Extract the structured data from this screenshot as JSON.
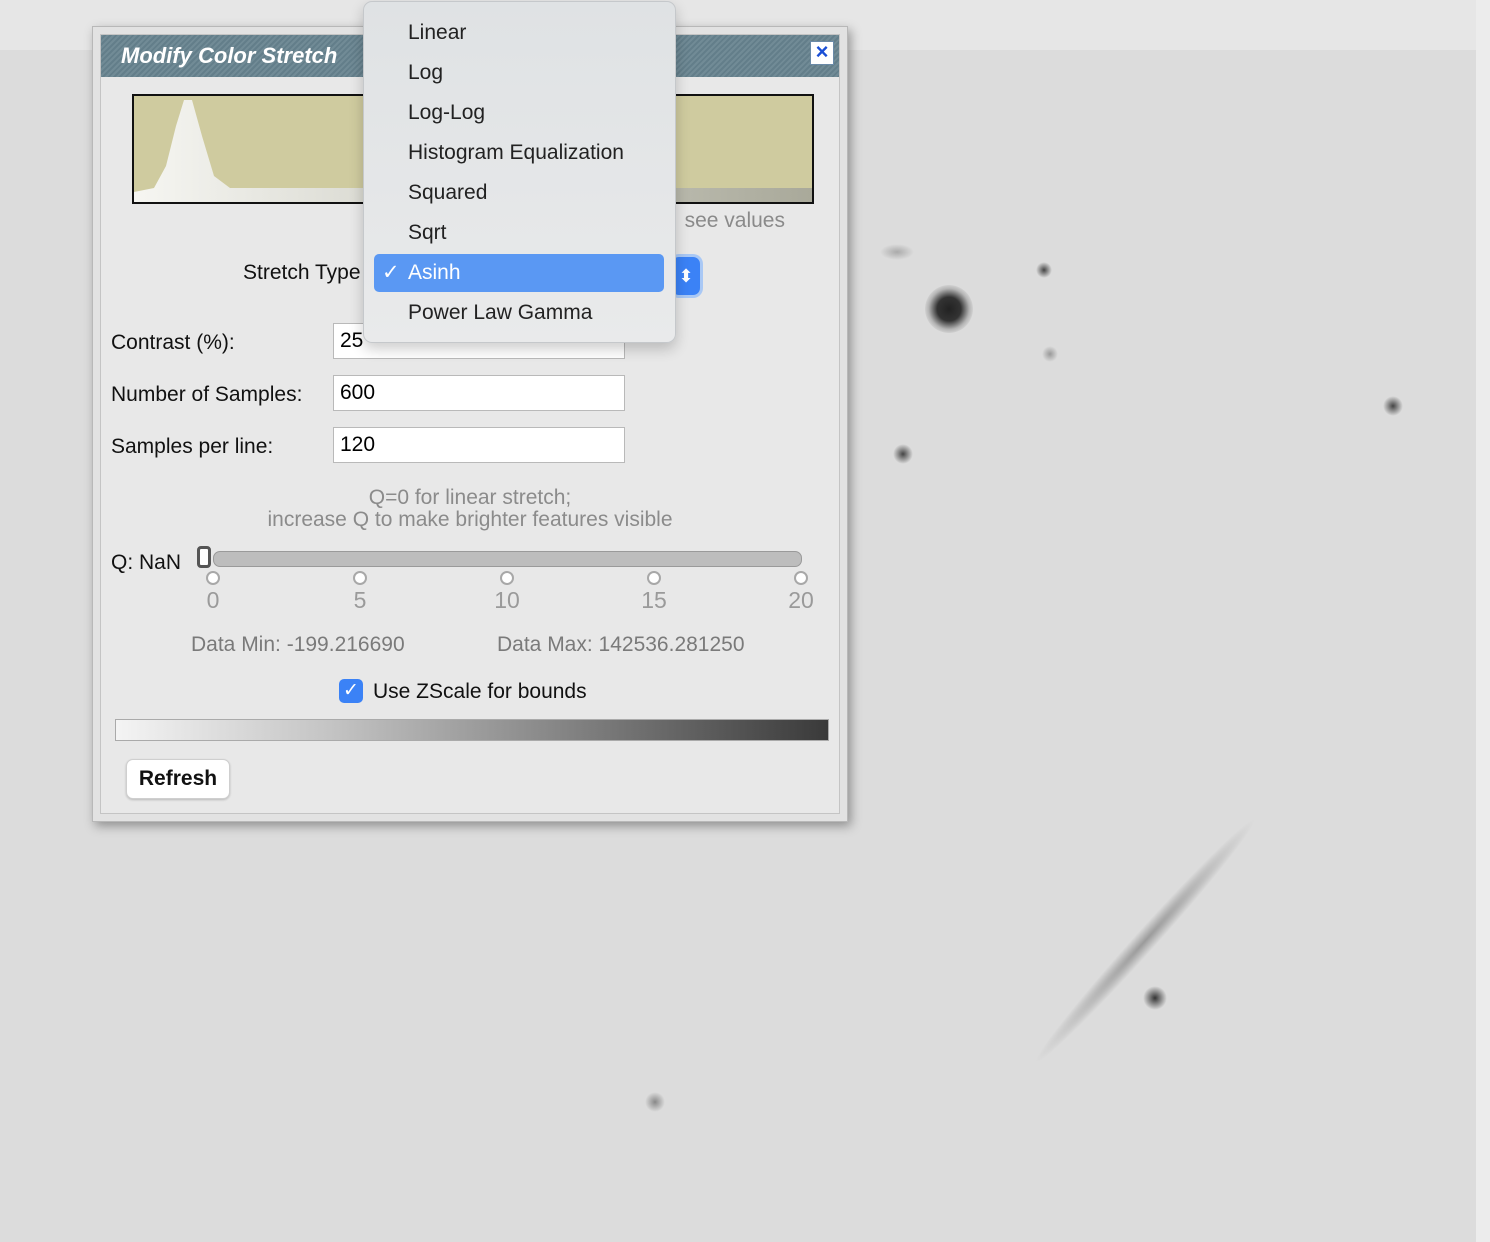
{
  "dialog": {
    "title": "Modify Color Stretch",
    "close_icon": "close-icon",
    "histogram_hint": "see values",
    "stretch_type_label": "Stretch Type",
    "contrast_label": "Contrast (%):",
    "contrast_value": "25",
    "samples_label": "Number of Samples:",
    "samples_value": "600",
    "per_line_label": "Samples per line:",
    "per_line_value": "120",
    "q_help_line1": "Q=0 for linear stretch;",
    "q_help_line2": "increase Q to make brighter features visible",
    "q_label": "Q: NaN",
    "q_ticks": [
      "0",
      "5",
      "10",
      "15",
      "20"
    ],
    "data_min": "Data Min: -199.216690",
    "data_max": "Data Max: 142536.281250",
    "zscale_label": "Use ZScale for bounds",
    "zscale_checked": true,
    "refresh_label": "Refresh"
  },
  "dropdown": {
    "options": [
      "Linear",
      "Log",
      "Log-Log",
      "Histogram Equalization",
      "Squared",
      "Sqrt",
      "Asinh",
      "Power Law Gamma"
    ],
    "selected": "Asinh",
    "check_glyph": "✓"
  },
  "colors": {
    "titlebar": "#66828e",
    "histogram_fill": "#cfcb9f",
    "selection": "#5a98f3"
  }
}
